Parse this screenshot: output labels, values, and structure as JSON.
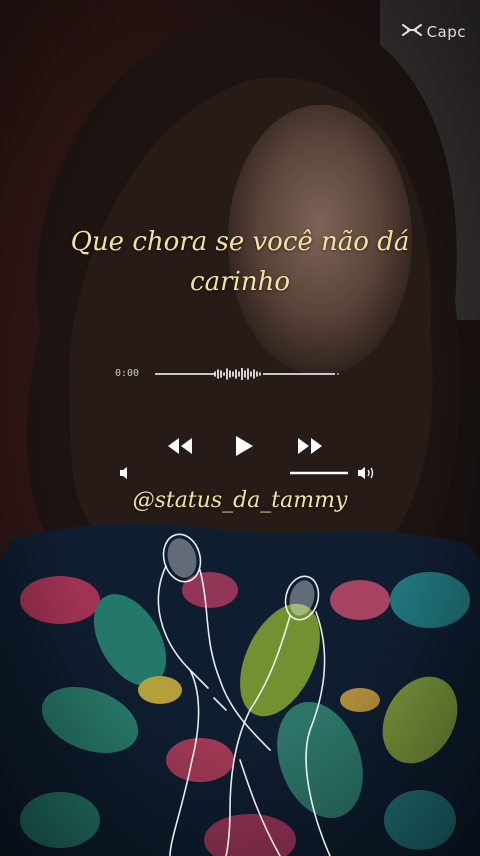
{
  "watermark": {
    "text": "Capc",
    "icon": "capcut-logo-icon"
  },
  "lyric": {
    "line1": "Que chora se você não dá",
    "line2": "carinho"
  },
  "player": {
    "elapsed": "0:00",
    "progress": 0.0,
    "volume_level": 0.6,
    "icons": [
      "rewind-icon",
      "play-icon",
      "fast-forward-icon",
      "volume-low-icon",
      "volume-high-icon"
    ]
  },
  "handle": "@status_da_tammy",
  "colors": {
    "lyric": "#f2e2a2",
    "ui_white": "#ffffff"
  }
}
